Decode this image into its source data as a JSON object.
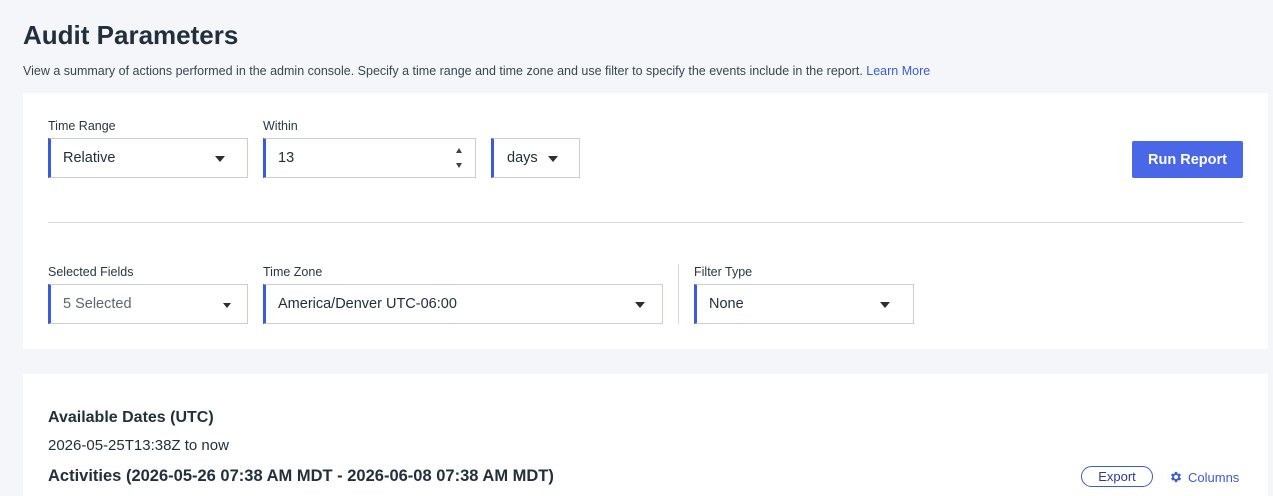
{
  "header": {
    "title": "Audit Parameters",
    "description": "View a summary of actions performed in the admin console. Specify a time range and time zone and use filter to specify the events include in the report.",
    "learn_more": "Learn More"
  },
  "params": {
    "time_range": {
      "label": "Time Range",
      "value": "Relative"
    },
    "within": {
      "label": "Within",
      "value": "13"
    },
    "unit": {
      "value": "days"
    },
    "run_report": "Run Report",
    "selected_fields": {
      "label": "Selected Fields",
      "value": "5 Selected"
    },
    "time_zone": {
      "label": "Time Zone",
      "value": "America/Denver UTC-06:00"
    },
    "filter_type": {
      "label": "Filter Type",
      "value": "None"
    }
  },
  "results": {
    "available_dates_title": "Available Dates (UTC)",
    "available_dates_value": "2026-05-25T13:38Z to now",
    "activities_title": "Activities (2026-05-26 07:38 AM MDT - 2026-06-08 07:38 AM MDT)",
    "export": "Export",
    "columns": "Columns"
  },
  "icons": {
    "dropdown": "chevron-down-icon",
    "stepper": "stepper-icon",
    "columns": "gear-icon"
  },
  "colors": {
    "accent": "#3b5bdb",
    "button": "#4a67e8",
    "background": "#f5f6fa"
  }
}
